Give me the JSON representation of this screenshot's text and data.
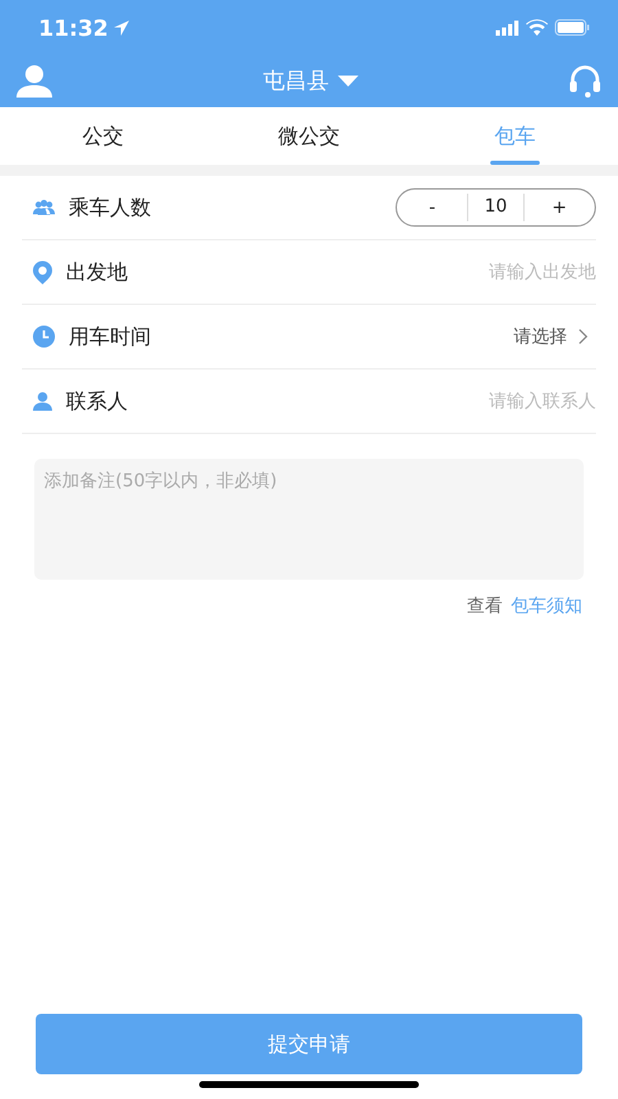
{
  "status_bar": {
    "time": "11:32"
  },
  "header": {
    "city": "屯昌县"
  },
  "tabs": [
    {
      "label": "公交",
      "selected": false
    },
    {
      "label": "微公交",
      "selected": false
    },
    {
      "label": "包车",
      "selected": true
    }
  ],
  "form": [
    {
      "kind": "stepper",
      "label": "乘车人数",
      "minus": "-",
      "value": "10",
      "plus": "+"
    },
    {
      "kind": "input",
      "label": "出发地",
      "placeholder": "请输入出发地"
    },
    {
      "kind": "select",
      "label": "用车时间",
      "value": "请选择"
    },
    {
      "kind": "input",
      "label": "联系人",
      "placeholder": "请输入联系人"
    }
  ],
  "notes": {
    "placeholder": "添加备注(50字以内，非必填)"
  },
  "notice": {
    "prefix": "查看",
    "link": "包车须知"
  },
  "submit": "提交申请"
}
